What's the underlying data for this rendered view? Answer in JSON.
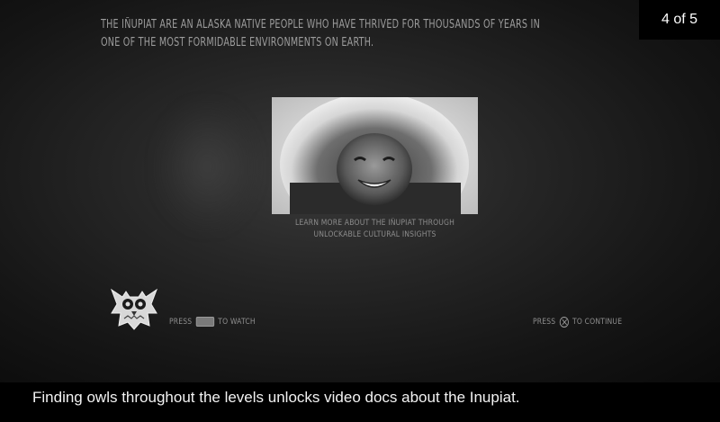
{
  "slide": {
    "headline_line1": "The Iñupiat are an Alaska Native people who have thrived for thousands of years in",
    "headline_line2": "one of the most formidable environments on earth.",
    "counter": "4 of 5",
    "insight_line1": "Learn more about the Iñupiat through",
    "insight_line2": "unlockable cultural insights",
    "prompt_watch_before": "Press",
    "prompt_watch_after": "to watch",
    "prompt_continue_before": "Press",
    "prompt_continue_after": "to continue",
    "icons": [
      "owl-icon",
      "touchpad-button-icon",
      "cross-button-icon"
    ]
  },
  "caption": "Finding owls throughout the levels unlocks video docs about the Inupiat."
}
